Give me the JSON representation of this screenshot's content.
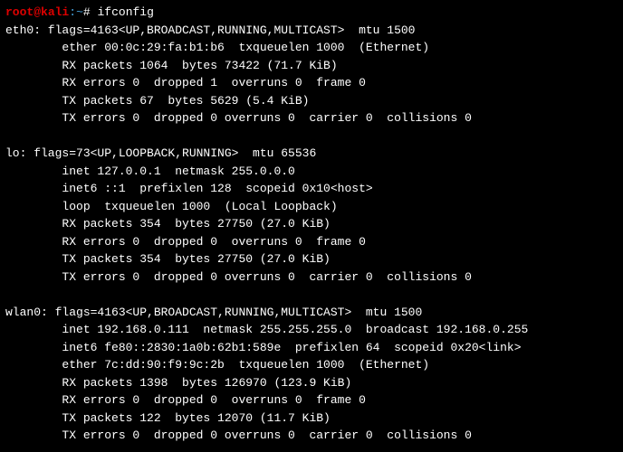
{
  "prompt": {
    "user": "root",
    "at": "@",
    "host": "kali",
    "sep": ":",
    "path": "~",
    "hash": "#",
    "command": "ifconfig"
  },
  "eth0": {
    "header": "eth0: flags=4163<UP,BROADCAST,RUNNING,MULTICAST>  mtu 1500",
    "l1": "        ether 00:0c:29:fa:b1:b6  txqueuelen 1000  (Ethernet)",
    "l2": "        RX packets 1064  bytes 73422 (71.7 KiB)",
    "l3": "        RX errors 0  dropped 1  overruns 0  frame 0",
    "l4": "        TX packets 67  bytes 5629 (5.4 KiB)",
    "l5": "        TX errors 0  dropped 0 overruns 0  carrier 0  collisions 0"
  },
  "lo": {
    "header": "lo: flags=73<UP,LOOPBACK,RUNNING>  mtu 65536",
    "l1": "        inet 127.0.0.1  netmask 255.0.0.0",
    "l2": "        inet6 ::1  prefixlen 128  scopeid 0x10<host>",
    "l3": "        loop  txqueuelen 1000  (Local Loopback)",
    "l4": "        RX packets 354  bytes 27750 (27.0 KiB)",
    "l5": "        RX errors 0  dropped 0  overruns 0  frame 0",
    "l6": "        TX packets 354  bytes 27750 (27.0 KiB)",
    "l7": "        TX errors 0  dropped 0 overruns 0  carrier 0  collisions 0"
  },
  "wlan0": {
    "header": "wlan0: flags=4163<UP,BROADCAST,RUNNING,MULTICAST>  mtu 1500",
    "l1": "        inet 192.168.0.111  netmask 255.255.255.0  broadcast 192.168.0.255",
    "l2": "        inet6 fe80::2830:1a0b:62b1:589e  prefixlen 64  scopeid 0x20<link>",
    "l3": "        ether 7c:dd:90:f9:9c:2b  txqueuelen 1000  (Ethernet)",
    "l4": "        RX packets 1398  bytes 126970 (123.9 KiB)",
    "l5": "        RX errors 0  dropped 0  overruns 0  frame 0",
    "l6": "        TX packets 122  bytes 12070 (11.7 KiB)",
    "l7": "        TX errors 0  dropped 0 overruns 0  carrier 0  collisions 0"
  }
}
